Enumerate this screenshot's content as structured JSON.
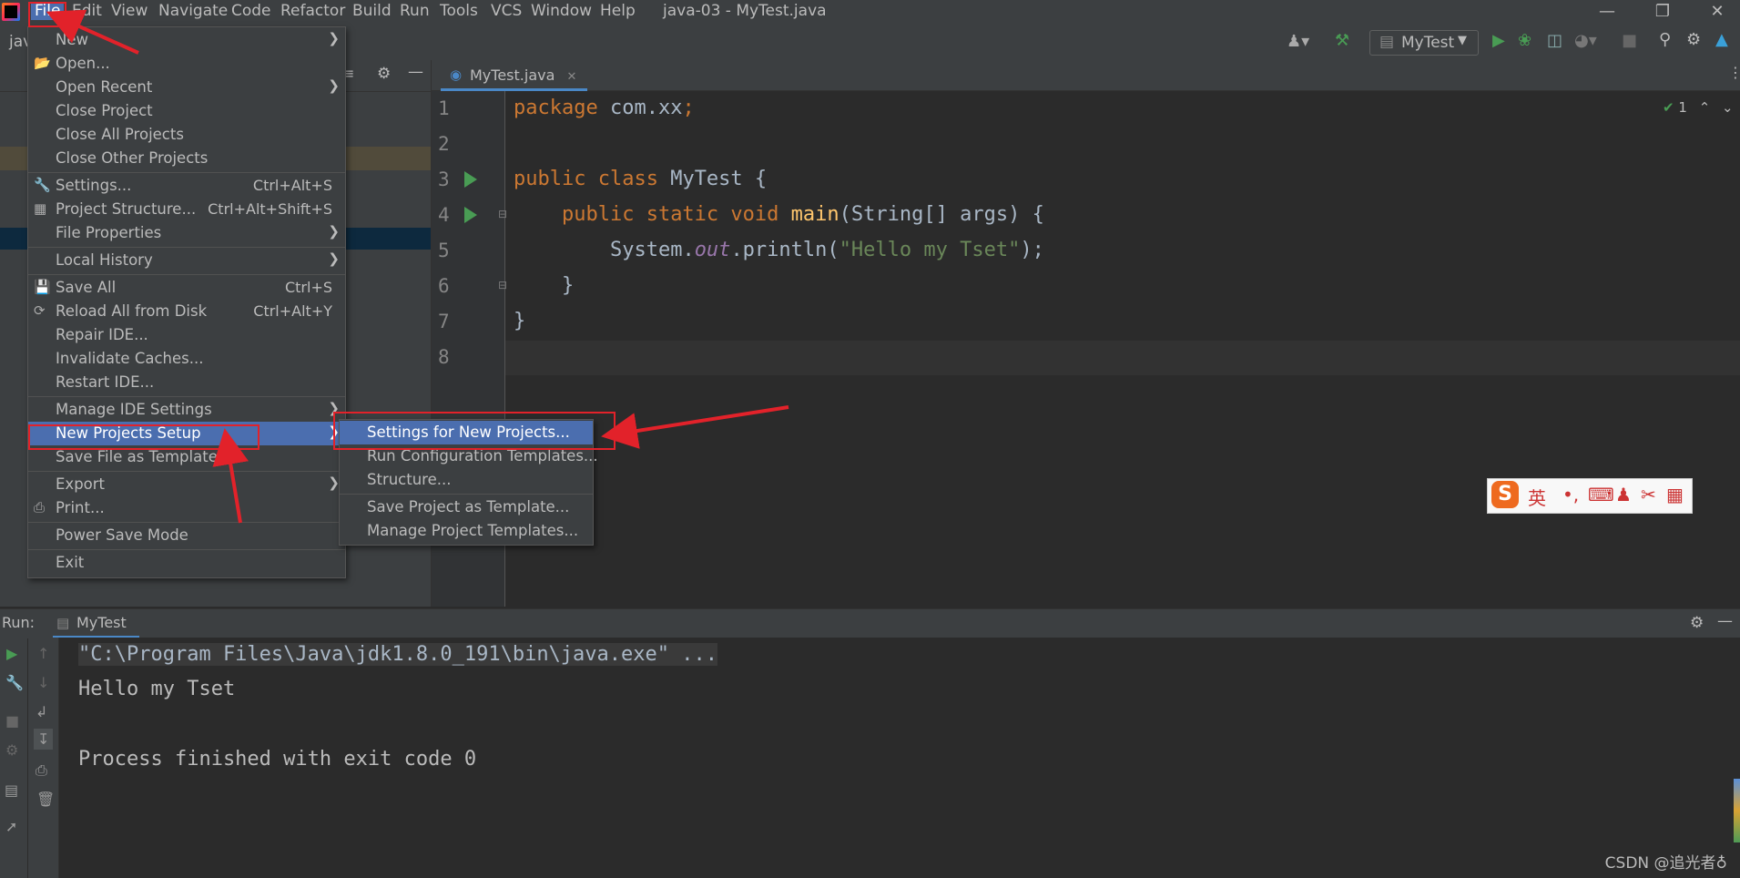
{
  "menubar": {
    "items": [
      "File",
      "Edit",
      "View",
      "Navigate",
      "Code",
      "Refactor",
      "Build",
      "Run",
      "Tools",
      "VCS",
      "Window",
      "Help"
    ],
    "window_title": "java-03 - MyTest.java"
  },
  "toolbar": {
    "project_crumb": "jav",
    "run_config": "MyTest",
    "code_badge": "1"
  },
  "editor": {
    "tab": "MyTest.java",
    "line_numbers": [
      "1",
      "2",
      "3",
      "4",
      "5",
      "6",
      "7",
      "8"
    ],
    "code": {
      "l1_kw": "package",
      "l1_rest": " com.xx",
      "l3_kw": "public class",
      "l3_rest": " MyTest {",
      "l4_kw": "public static void",
      "l4_fn": "main",
      "l4_rest": "(String[] args) {",
      "l5_a": "System.",
      "l5_field": "out",
      "l5_b": ".println(",
      "l5_str": "\"Hello my Tset\"",
      "l5_c": ");",
      "l6": "}",
      "l7": "}"
    }
  },
  "file_menu": {
    "items": [
      {
        "label": "New",
        "shortcut": "",
        "submenu": true
      },
      {
        "label": "Open...",
        "shortcut": "",
        "submenu": false
      },
      {
        "label": "Open Recent",
        "shortcut": "",
        "submenu": true
      },
      {
        "label": "Close Project",
        "shortcut": "",
        "submenu": false
      },
      {
        "label": "Close All Projects",
        "shortcut": "",
        "submenu": false
      },
      {
        "label": "Close Other Projects",
        "shortcut": "",
        "submenu": false
      },
      {
        "label": "Settings...",
        "shortcut": "Ctrl+Alt+S",
        "submenu": false
      },
      {
        "label": "Project Structure...",
        "shortcut": "Ctrl+Alt+Shift+S",
        "submenu": false
      },
      {
        "label": "File Properties",
        "shortcut": "",
        "submenu": true
      },
      {
        "label": "Local History",
        "shortcut": "",
        "submenu": true
      },
      {
        "label": "Save All",
        "shortcut": "Ctrl+S",
        "submenu": false
      },
      {
        "label": "Reload All from Disk",
        "shortcut": "Ctrl+Alt+Y",
        "submenu": false
      },
      {
        "label": "Repair IDE...",
        "shortcut": "",
        "submenu": false
      },
      {
        "label": "Invalidate Caches...",
        "shortcut": "",
        "submenu": false
      },
      {
        "label": "Restart IDE...",
        "shortcut": "",
        "submenu": false
      },
      {
        "label": "Manage IDE Settings",
        "shortcut": "",
        "submenu": true
      },
      {
        "label": "New Projects Setup",
        "shortcut": "",
        "submenu": true
      },
      {
        "label": "Save File as Template...",
        "shortcut": "",
        "submenu": false
      },
      {
        "label": "Export",
        "shortcut": "",
        "submenu": true
      },
      {
        "label": "Print...",
        "shortcut": "",
        "submenu": false
      },
      {
        "label": "Power Save Mode",
        "shortcut": "",
        "submenu": false
      },
      {
        "label": "Exit",
        "shortcut": "",
        "submenu": false
      }
    ]
  },
  "submenu": {
    "items": [
      "Settings for New Projects...",
      "Run Configuration Templates...",
      "Structure...",
      "Save Project as Template...",
      "Manage Project Templates..."
    ]
  },
  "ime": {
    "lang": "英",
    "punct": "•,"
  },
  "run_panel": {
    "label": "Run:",
    "tab": "MyTest",
    "output": [
      "\"C:\\Program Files\\Java\\jdk1.8.0_191\\bin\\java.exe\" ...",
      "Hello my Tset",
      "",
      "Process finished with exit code 0"
    ]
  },
  "watermark": "CSDN @追光者♁",
  "colors": {
    "accent": "#4b6eaf",
    "annotation": "#e2222a",
    "run_green": "#499c54"
  }
}
